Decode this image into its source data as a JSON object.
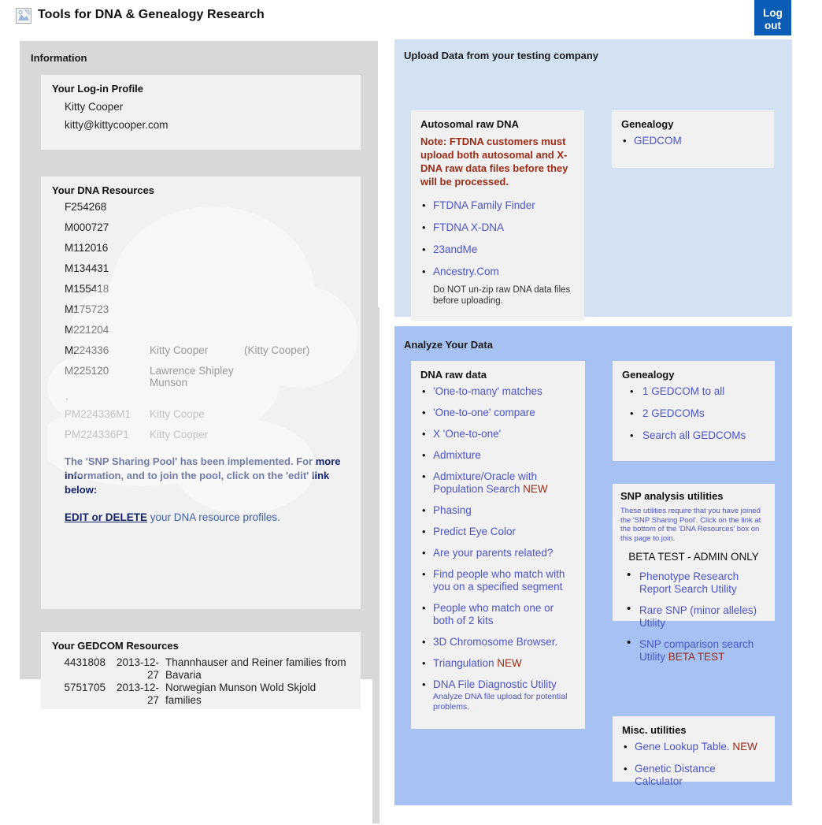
{
  "header": {
    "title": "Tools for DNA & Genealogy Research",
    "logo_icon": "broken-image-icon",
    "logout_line1": "Log",
    "logout_line2": "out"
  },
  "information": {
    "title": "Information",
    "login_profile": {
      "title": "Your Log-in Profile",
      "name": "Kitty Cooper",
      "email": "kitty@kittycooper.com"
    },
    "dna_resources": {
      "title": "Your DNA Resources",
      "rows": [
        {
          "kit": "F254268",
          "name": "",
          "alias": ""
        },
        {
          "kit": "M000727",
          "name": "",
          "alias": ""
        },
        {
          "kit": "M112016",
          "name": "",
          "alias": ""
        },
        {
          "kit": "M134431",
          "name": "",
          "alias": ""
        },
        {
          "kit": "M155418",
          "name": "",
          "alias": ""
        },
        {
          "kit": "M175723",
          "name": "",
          "alias": ""
        },
        {
          "kit": "M221204",
          "name": "",
          "alias": ""
        },
        {
          "kit": "M224336",
          "name": "Kitty Cooper",
          "alias": "(Kitty Cooper)"
        },
        {
          "kit": "M225120",
          "name": "Lawrence Shipley Munson",
          "alias": ""
        }
      ],
      "separator_mark": "'",
      "phased_rows": [
        {
          "kit": "PM224336M1",
          "name": "Kitty Coope",
          "alias": ""
        },
        {
          "kit": "PM224336P1",
          "name": "Kitty Cooper",
          "alias": ""
        }
      ],
      "pool_note": "The 'SNP Sharing Pool' has been implemented. For more information, and to join the pool, click on the 'edit' link below:",
      "edit_link": "EDIT or DELETE",
      "edit_tail": " your DNA resource profiles."
    },
    "gedcom_resources": {
      "title": "Your GEDCOM Resources",
      "rows": [
        {
          "id": "4431808",
          "date": "2013-12-27",
          "desc": "Thannhauser and Reiner families from Bavaria"
        },
        {
          "id": "5751705",
          "date": "2013-12-27",
          "desc": "Norwegian Munson Wold Skjold families"
        }
      ]
    }
  },
  "upload": {
    "title": "Upload Data from your testing company",
    "autosomal": {
      "title": "Autosomal raw DNA",
      "warning": "Note: FTDNA customers must upload both autosomal and X-DNA raw data files before they will be processed.",
      "links": [
        "FTDNA Family Finder",
        "FTDNA X-DNA",
        "23andMe",
        "Ancestry.Com"
      ],
      "subnote": "Do NOT un-zip raw DNA data files before uploading."
    },
    "genealogy": {
      "title": "Genealogy",
      "links": [
        "GEDCOM"
      ]
    }
  },
  "analyze": {
    "title": "Analyze Your Data",
    "dna_raw_data": {
      "title": "DNA raw data",
      "items": [
        {
          "label": "'One-to-many' matches",
          "tag": "",
          "caption": ""
        },
        {
          "label": "'One-to-one' compare",
          "tag": "",
          "caption": ""
        },
        {
          "label": "X 'One-to-one'",
          "tag": "",
          "caption": ""
        },
        {
          "label": "Admixture",
          "tag": "",
          "caption": ""
        },
        {
          "label": "Admixture/Oracle with Population Search",
          "tag": "NEW",
          "caption": ""
        },
        {
          "label": "Phasing",
          "tag": "",
          "caption": ""
        },
        {
          "label": "Predict Eye Color",
          "tag": "",
          "caption": ""
        },
        {
          "label": "Are your parents related?",
          "tag": "",
          "caption": ""
        },
        {
          "label": "Find people who match with you on a specified segment",
          "tag": "",
          "caption": ""
        },
        {
          "label": "People who match one or both of 2 kits",
          "tag": "",
          "caption": ""
        },
        {
          "label": "3D Chromosome Browser.",
          "tag": "",
          "caption": ""
        },
        {
          "label": "Triangulation",
          "tag": "NEW",
          "caption": ""
        },
        {
          "label": "DNA File Diagnostic Utility",
          "tag": "",
          "caption": "Analyze DNA file upload for potential problems."
        }
      ]
    },
    "genealogy": {
      "title": "Genealogy",
      "items": [
        "1 GEDCOM to all",
        "2 GEDCOMs",
        "Search all GEDCOMs"
      ]
    },
    "snp_utilities": {
      "title": "SNP analysis utilities",
      "description": "These utilities require that you have joined the 'SNP Sharing Pool'. Click on the link at the bottom of the 'DNA Resources' box on this page to join.",
      "beta_header": "BETA TEST - ADMIN ONLY",
      "items": [
        {
          "label": "Phenotype Research Report Search Utility",
          "tag": ""
        },
        {
          "label": "Rare SNP (minor alleles) Utility",
          "tag": ""
        },
        {
          "label": "SNP comparison search Utility",
          "tag": "BETA TEST"
        }
      ]
    },
    "misc_utilities": {
      "title": "Misc. utilities",
      "items": [
        {
          "label": "Gene Lookup Table.",
          "tag": "NEW"
        },
        {
          "label": "Genetic Distance Calculator",
          "tag": ""
        }
      ]
    }
  },
  "colors": {
    "logout_bg": "#0b5cb5",
    "info_panel_bg": "#d8d8d8",
    "upload_panel_bg": "#d3e2f2",
    "analyze_panel_bg": "#a5c2f2",
    "card_bg": "#f1f1f1",
    "link": "#4a54c9",
    "warning": "#9b2b16",
    "note": "#16246b"
  }
}
